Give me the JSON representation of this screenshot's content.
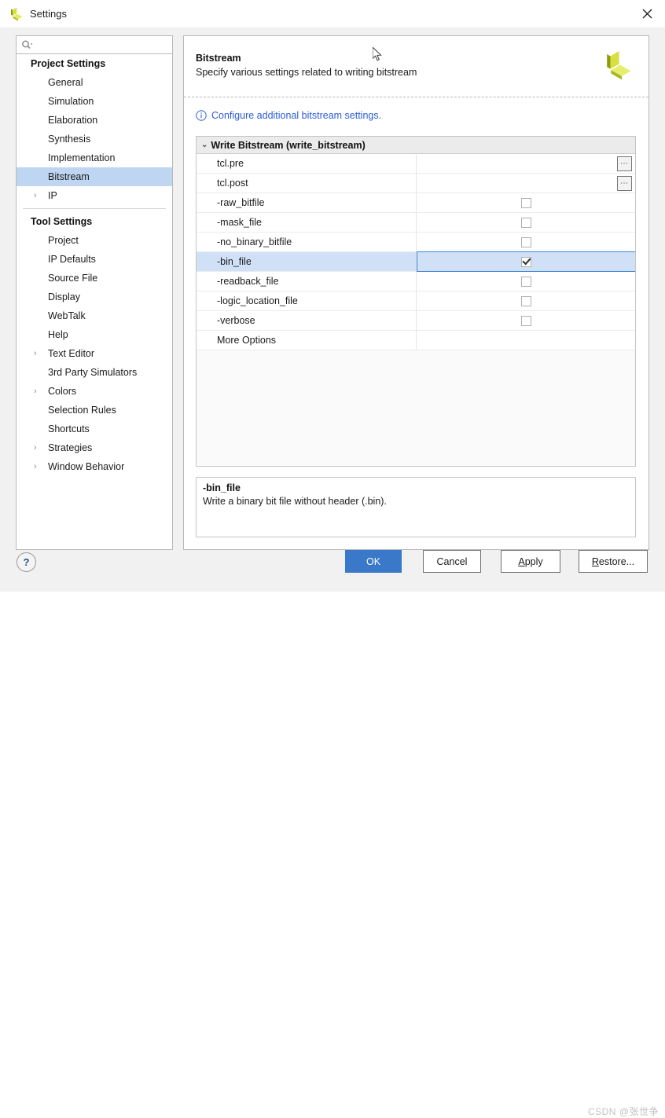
{
  "window": {
    "title": "Settings",
    "logo_icon": "xilinx-logo-icon",
    "close_icon": "close-icon"
  },
  "search": {
    "value": "",
    "placeholder": "",
    "icon": "search-icon"
  },
  "sidebar": {
    "groups": [
      {
        "title": "Project Settings",
        "items": [
          {
            "label": "General",
            "expandable": false,
            "selected": false
          },
          {
            "label": "Simulation",
            "expandable": false,
            "selected": false
          },
          {
            "label": "Elaboration",
            "expandable": false,
            "selected": false
          },
          {
            "label": "Synthesis",
            "expandable": false,
            "selected": false
          },
          {
            "label": "Implementation",
            "expandable": false,
            "selected": false
          },
          {
            "label": "Bitstream",
            "expandable": false,
            "selected": true
          },
          {
            "label": "IP",
            "expandable": true,
            "selected": false
          }
        ]
      },
      {
        "title": "Tool Settings",
        "items": [
          {
            "label": "Project",
            "expandable": false,
            "selected": false
          },
          {
            "label": "IP Defaults",
            "expandable": false,
            "selected": false
          },
          {
            "label": "Source File",
            "expandable": false,
            "selected": false
          },
          {
            "label": "Display",
            "expandable": false,
            "selected": false
          },
          {
            "label": "WebTalk",
            "expandable": false,
            "selected": false
          },
          {
            "label": "Help",
            "expandable": false,
            "selected": false
          },
          {
            "label": "Text Editor",
            "expandable": true,
            "selected": false
          },
          {
            "label": "3rd Party Simulators",
            "expandable": false,
            "selected": false
          },
          {
            "label": "Colors",
            "expandable": true,
            "selected": false
          },
          {
            "label": "Selection Rules",
            "expandable": false,
            "selected": false
          },
          {
            "label": "Shortcuts",
            "expandable": false,
            "selected": false
          },
          {
            "label": "Strategies",
            "expandable": true,
            "selected": false
          },
          {
            "label": "Window Behavior",
            "expandable": true,
            "selected": false
          }
        ]
      }
    ],
    "expand_glyph": "›"
  },
  "panel": {
    "title": "Bitstream",
    "subtitle": "Specify various settings related to writing bitstream",
    "logo_icon": "xilinx-logo-icon",
    "info_icon": "info-circle-icon",
    "info_link": "Configure additional bitstream settings."
  },
  "table": {
    "group_header": "Write Bitstream (write_bitstream)",
    "group_twisty": "⌄",
    "browse_label": "⋯",
    "rows": [
      {
        "name": "tcl.pre",
        "control": "browse",
        "checked": false,
        "selected": false
      },
      {
        "name": "tcl.post",
        "control": "browse",
        "checked": false,
        "selected": false
      },
      {
        "name": "-raw_bitfile",
        "control": "checkbox",
        "checked": false,
        "selected": false
      },
      {
        "name": "-mask_file",
        "control": "checkbox",
        "checked": false,
        "selected": false
      },
      {
        "name": "-no_binary_bitfile",
        "control": "checkbox",
        "checked": false,
        "selected": false
      },
      {
        "name": "-bin_file",
        "control": "checkbox",
        "checked": true,
        "selected": true
      },
      {
        "name": "-readback_file",
        "control": "checkbox",
        "checked": false,
        "selected": false
      },
      {
        "name": "-logic_location_file",
        "control": "checkbox",
        "checked": false,
        "selected": false
      },
      {
        "name": "-verbose",
        "control": "checkbox",
        "checked": false,
        "selected": false
      },
      {
        "name": "More Options",
        "control": "none",
        "checked": false,
        "selected": false
      }
    ]
  },
  "description": {
    "title": "-bin_file",
    "text": "Write a binary bit file without header (.bin)."
  },
  "footer": {
    "help_label": "?",
    "ok_label": "OK",
    "cancel_label": "Cancel",
    "apply_label": "Apply",
    "apply_mnemonic": "A",
    "apply_rest": "pply",
    "restore_label": "Restore...",
    "restore_mnemonic": "R",
    "restore_rest": "estore..."
  },
  "watermark": "CSDN @张世争",
  "colors": {
    "primary_button": "#3a78c9",
    "selection": "#bed6f2",
    "link": "#2b5cd6",
    "logo_light": "#d6e03f",
    "logo_dark": "#9ba513"
  }
}
